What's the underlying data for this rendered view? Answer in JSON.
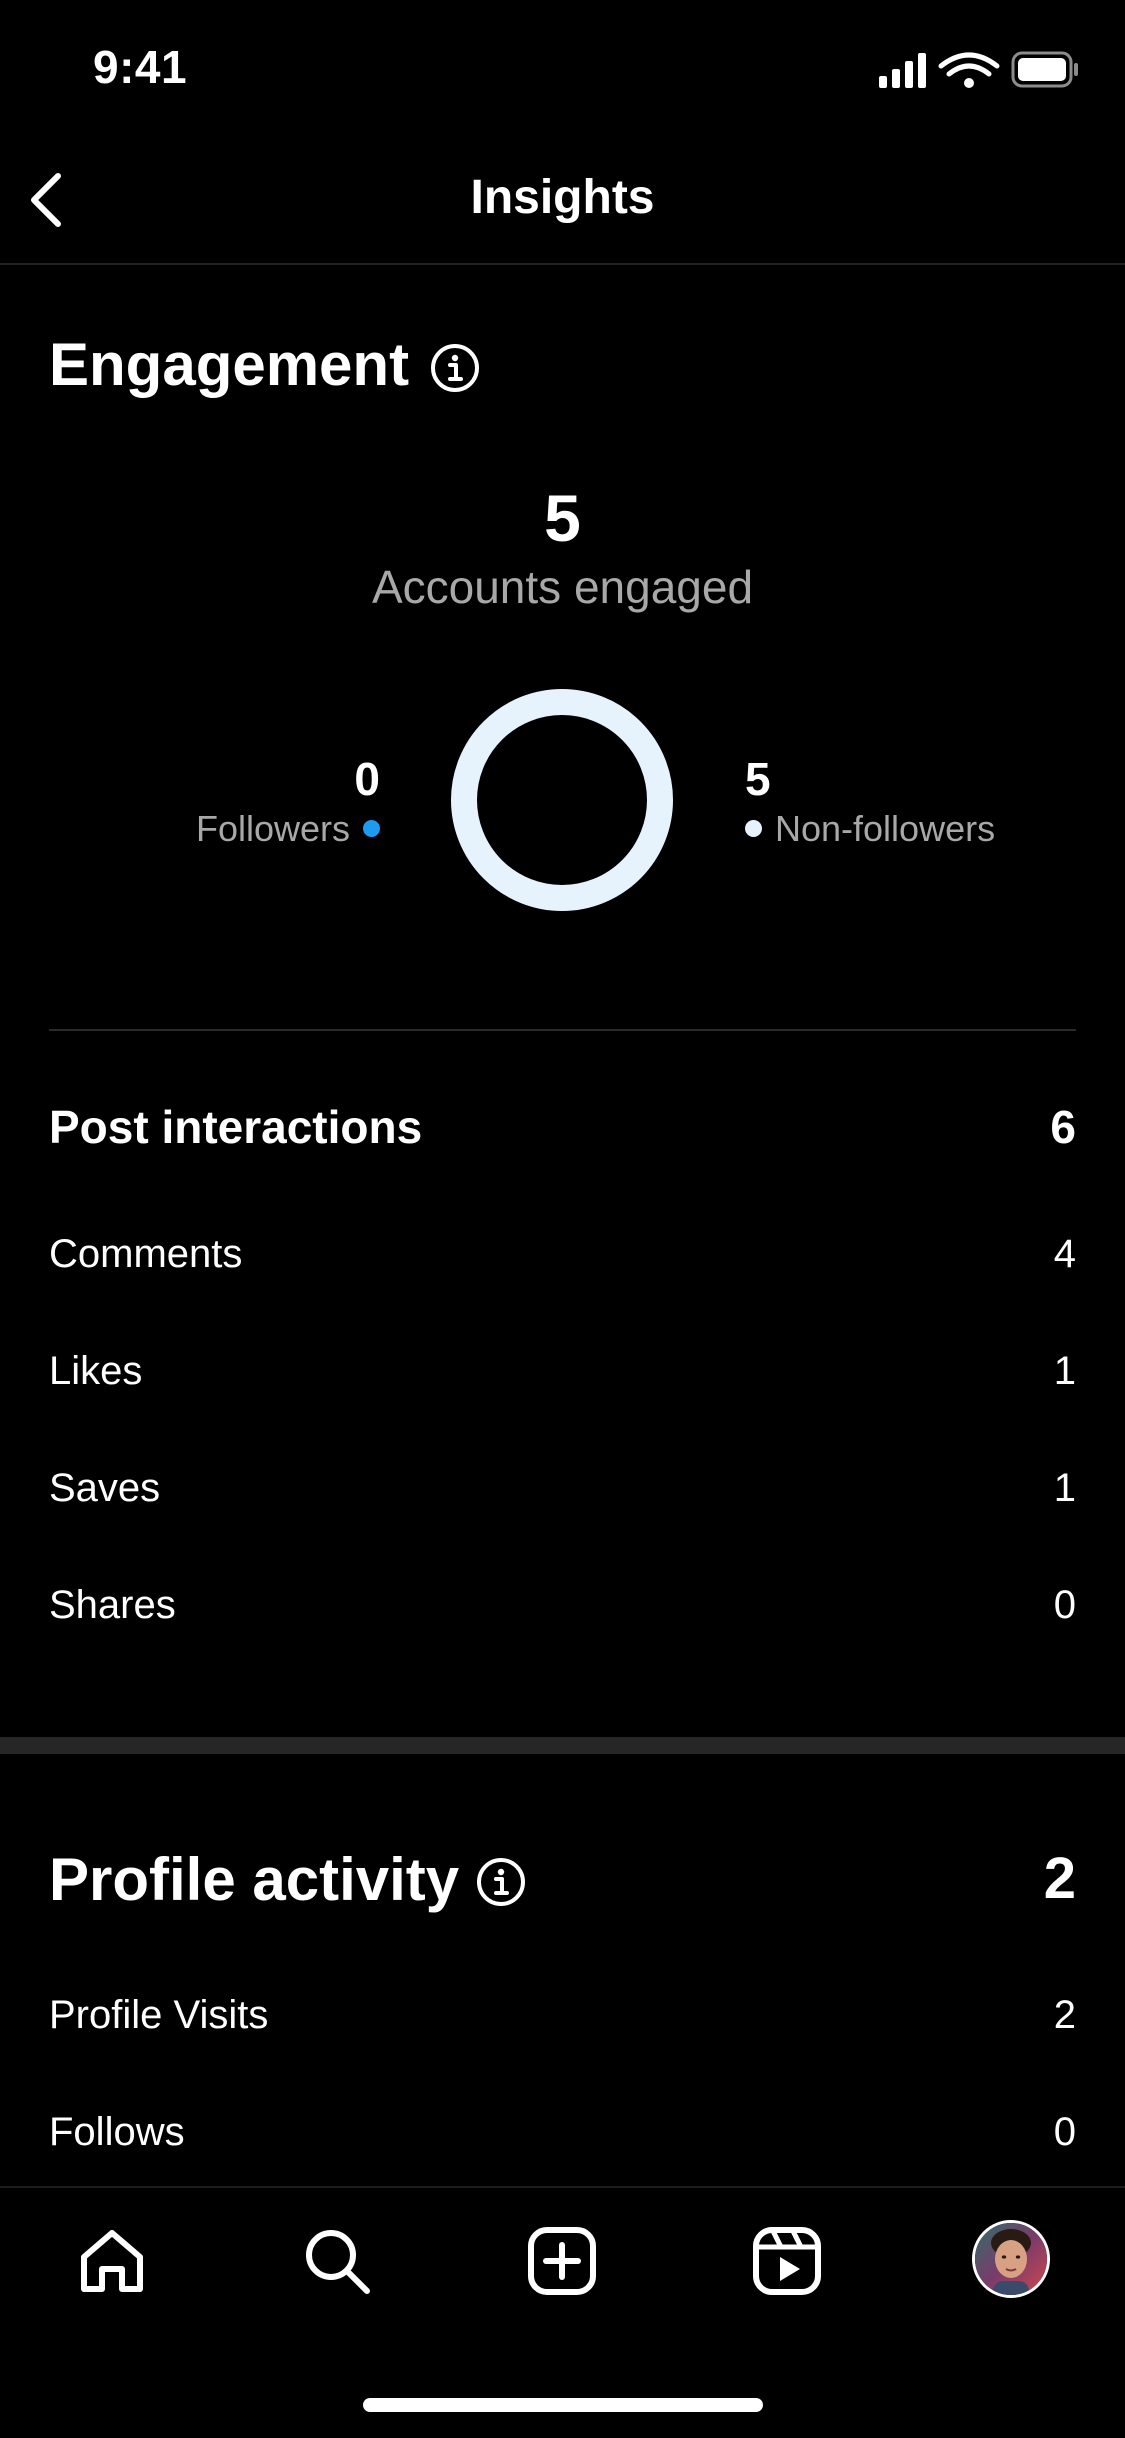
{
  "status_bar": {
    "time": "9:41"
  },
  "header": {
    "title": "Insights"
  },
  "engagement": {
    "title": "Engagement",
    "accounts_engaged_value": "5",
    "accounts_engaged_label": "Accounts engaged",
    "followers_value": "0",
    "followers_label": "Followers",
    "non_followers_value": "5",
    "non_followers_label": "Non-followers",
    "followers_share": 0,
    "non_followers_share": 1,
    "colors": {
      "followers": "#1d9bf0",
      "non_followers": "#e6f3fd"
    }
  },
  "post_interactions": {
    "title": "Post interactions",
    "total": "6",
    "rows": [
      {
        "label": "Comments",
        "value": "4"
      },
      {
        "label": "Likes",
        "value": "1"
      },
      {
        "label": "Saves",
        "value": "1"
      },
      {
        "label": "Shares",
        "value": "0"
      }
    ]
  },
  "profile_activity": {
    "title": "Profile activity",
    "total": "2",
    "rows": [
      {
        "label": "Profile Visits",
        "value": "2"
      },
      {
        "label": "Follows",
        "value": "0"
      }
    ]
  },
  "nav": {
    "items": [
      "home-icon",
      "search-icon",
      "create-icon",
      "reels-icon",
      "profile-avatar"
    ]
  }
}
